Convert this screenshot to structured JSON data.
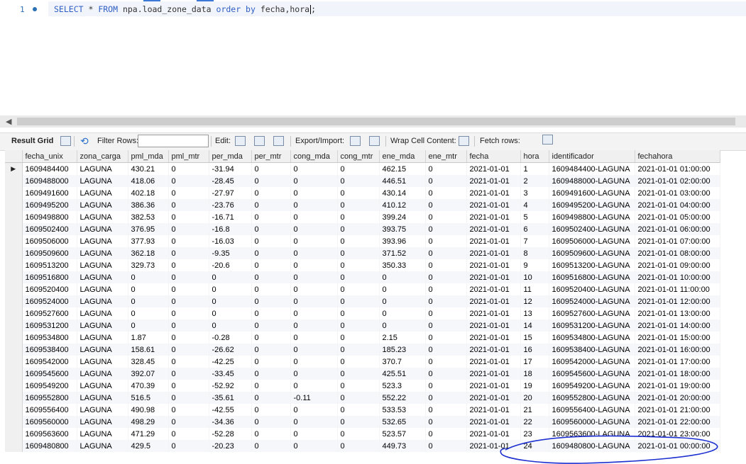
{
  "editor": {
    "line_number": "1",
    "sql": [
      {
        "t": "SELECT",
        "kw": true
      },
      {
        "t": " * ",
        "kw": false
      },
      {
        "t": "FROM",
        "kw": true
      },
      {
        "t": " npa.load_zone_data ",
        "kw": false
      },
      {
        "t": "order by",
        "kw": true
      },
      {
        "t": " fecha,hora",
        "kw": false
      },
      {
        "t": ";",
        "kw": false
      }
    ]
  },
  "toolbar": {
    "result_grid": "Result Grid",
    "filter_rows": "Filter Rows:",
    "filter_value": "",
    "edit": "Edit:",
    "export_import": "Export/Import:",
    "wrap_cell": "Wrap Cell Content:",
    "fetch_rows": "Fetch rows:"
  },
  "grid": {
    "columns": [
      "fecha_unix",
      "zona_carga",
      "pml_mda",
      "pml_mtr",
      "per_mda",
      "per_mtr",
      "cong_mda",
      "cong_mtr",
      "ene_mda",
      "ene_mtr",
      "fecha",
      "hora",
      "identificador",
      "fechahora"
    ],
    "rows": [
      [
        "1609484400",
        "LAGUNA",
        "430.21",
        "0",
        "-31.94",
        "0",
        "0",
        "0",
        "462.15",
        "0",
        "2021-01-01",
        "1",
        "1609484400-LAGUNA",
        "2021-01-01 01:00:00"
      ],
      [
        "1609488000",
        "LAGUNA",
        "418.06",
        "0",
        "-28.45",
        "0",
        "0",
        "0",
        "446.51",
        "0",
        "2021-01-01",
        "2",
        "1609488000-LAGUNA",
        "2021-01-01 02:00:00"
      ],
      [
        "1609491600",
        "LAGUNA",
        "402.18",
        "0",
        "-27.97",
        "0",
        "0",
        "0",
        "430.14",
        "0",
        "2021-01-01",
        "3",
        "1609491600-LAGUNA",
        "2021-01-01 03:00:00"
      ],
      [
        "1609495200",
        "LAGUNA",
        "386.36",
        "0",
        "-23.76",
        "0",
        "0",
        "0",
        "410.12",
        "0",
        "2021-01-01",
        "4",
        "1609495200-LAGUNA",
        "2021-01-01 04:00:00"
      ],
      [
        "1609498800",
        "LAGUNA",
        "382.53",
        "0",
        "-16.71",
        "0",
        "0",
        "0",
        "399.24",
        "0",
        "2021-01-01",
        "5",
        "1609498800-LAGUNA",
        "2021-01-01 05:00:00"
      ],
      [
        "1609502400",
        "LAGUNA",
        "376.95",
        "0",
        "-16.8",
        "0",
        "0",
        "0",
        "393.75",
        "0",
        "2021-01-01",
        "6",
        "1609502400-LAGUNA",
        "2021-01-01 06:00:00"
      ],
      [
        "1609506000",
        "LAGUNA",
        "377.93",
        "0",
        "-16.03",
        "0",
        "0",
        "0",
        "393.96",
        "0",
        "2021-01-01",
        "7",
        "1609506000-LAGUNA",
        "2021-01-01 07:00:00"
      ],
      [
        "1609509600",
        "LAGUNA",
        "362.18",
        "0",
        "-9.35",
        "0",
        "0",
        "0",
        "371.52",
        "0",
        "2021-01-01",
        "8",
        "1609509600-LAGUNA",
        "2021-01-01 08:00:00"
      ],
      [
        "1609513200",
        "LAGUNA",
        "329.73",
        "0",
        "-20.6",
        "0",
        "0",
        "0",
        "350.33",
        "0",
        "2021-01-01",
        "9",
        "1609513200-LAGUNA",
        "2021-01-01 09:00:00"
      ],
      [
        "1609516800",
        "LAGUNA",
        "0",
        "0",
        "0",
        "0",
        "0",
        "0",
        "0",
        "0",
        "2021-01-01",
        "10",
        "1609516800-LAGUNA",
        "2021-01-01 10:00:00"
      ],
      [
        "1609520400",
        "LAGUNA",
        "0",
        "0",
        "0",
        "0",
        "0",
        "0",
        "0",
        "0",
        "2021-01-01",
        "11",
        "1609520400-LAGUNA",
        "2021-01-01 11:00:00"
      ],
      [
        "1609524000",
        "LAGUNA",
        "0",
        "0",
        "0",
        "0",
        "0",
        "0",
        "0",
        "0",
        "2021-01-01",
        "12",
        "1609524000-LAGUNA",
        "2021-01-01 12:00:00"
      ],
      [
        "1609527600",
        "LAGUNA",
        "0",
        "0",
        "0",
        "0",
        "0",
        "0",
        "0",
        "0",
        "2021-01-01",
        "13",
        "1609527600-LAGUNA",
        "2021-01-01 13:00:00"
      ],
      [
        "1609531200",
        "LAGUNA",
        "0",
        "0",
        "0",
        "0",
        "0",
        "0",
        "0",
        "0",
        "2021-01-01",
        "14",
        "1609531200-LAGUNA",
        "2021-01-01 14:00:00"
      ],
      [
        "1609534800",
        "LAGUNA",
        "1.87",
        "0",
        "-0.28",
        "0",
        "0",
        "0",
        "2.15",
        "0",
        "2021-01-01",
        "15",
        "1609534800-LAGUNA",
        "2021-01-01 15:00:00"
      ],
      [
        "1609538400",
        "LAGUNA",
        "158.61",
        "0",
        "-26.62",
        "0",
        "0",
        "0",
        "185.23",
        "0",
        "2021-01-01",
        "16",
        "1609538400-LAGUNA",
        "2021-01-01 16:00:00"
      ],
      [
        "1609542000",
        "LAGUNA",
        "328.45",
        "0",
        "-42.25",
        "0",
        "0",
        "0",
        "370.7",
        "0",
        "2021-01-01",
        "17",
        "1609542000-LAGUNA",
        "2021-01-01 17:00:00"
      ],
      [
        "1609545600",
        "LAGUNA",
        "392.07",
        "0",
        "-33.45",
        "0",
        "0",
        "0",
        "425.51",
        "0",
        "2021-01-01",
        "18",
        "1609545600-LAGUNA",
        "2021-01-01 18:00:00"
      ],
      [
        "1609549200",
        "LAGUNA",
        "470.39",
        "0",
        "-52.92",
        "0",
        "0",
        "0",
        "523.3",
        "0",
        "2021-01-01",
        "19",
        "1609549200-LAGUNA",
        "2021-01-01 19:00:00"
      ],
      [
        "1609552800",
        "LAGUNA",
        "516.5",
        "0",
        "-35.61",
        "0",
        "-0.11",
        "0",
        "552.22",
        "0",
        "2021-01-01",
        "20",
        "1609552800-LAGUNA",
        "2021-01-01 20:00:00"
      ],
      [
        "1609556400",
        "LAGUNA",
        "490.98",
        "0",
        "-42.55",
        "0",
        "0",
        "0",
        "533.53",
        "0",
        "2021-01-01",
        "21",
        "1609556400-LAGUNA",
        "2021-01-01 21:00:00"
      ],
      [
        "1609560000",
        "LAGUNA",
        "498.29",
        "0",
        "-34.36",
        "0",
        "0",
        "0",
        "532.65",
        "0",
        "2021-01-01",
        "22",
        "1609560000-LAGUNA",
        "2021-01-01 22:00:00"
      ],
      [
        "1609563600",
        "LAGUNA",
        "471.29",
        "0",
        "-52.28",
        "0",
        "0",
        "0",
        "523.57",
        "0",
        "2021-01-01",
        "23",
        "1609563600-LAGUNA",
        "2021-01-01 23:00:00"
      ],
      [
        "1609480800",
        "LAGUNA",
        "429.5",
        "0",
        "-20.23",
        "0",
        "0",
        "0",
        "449.73",
        "0",
        "2021-01-01",
        "24",
        "1609480800-LAGUNA",
        "2021-01-01 00:00:00"
      ]
    ]
  },
  "colors": {
    "keyword": "#2f5ec4",
    "annotation": "#1c2fd0"
  }
}
